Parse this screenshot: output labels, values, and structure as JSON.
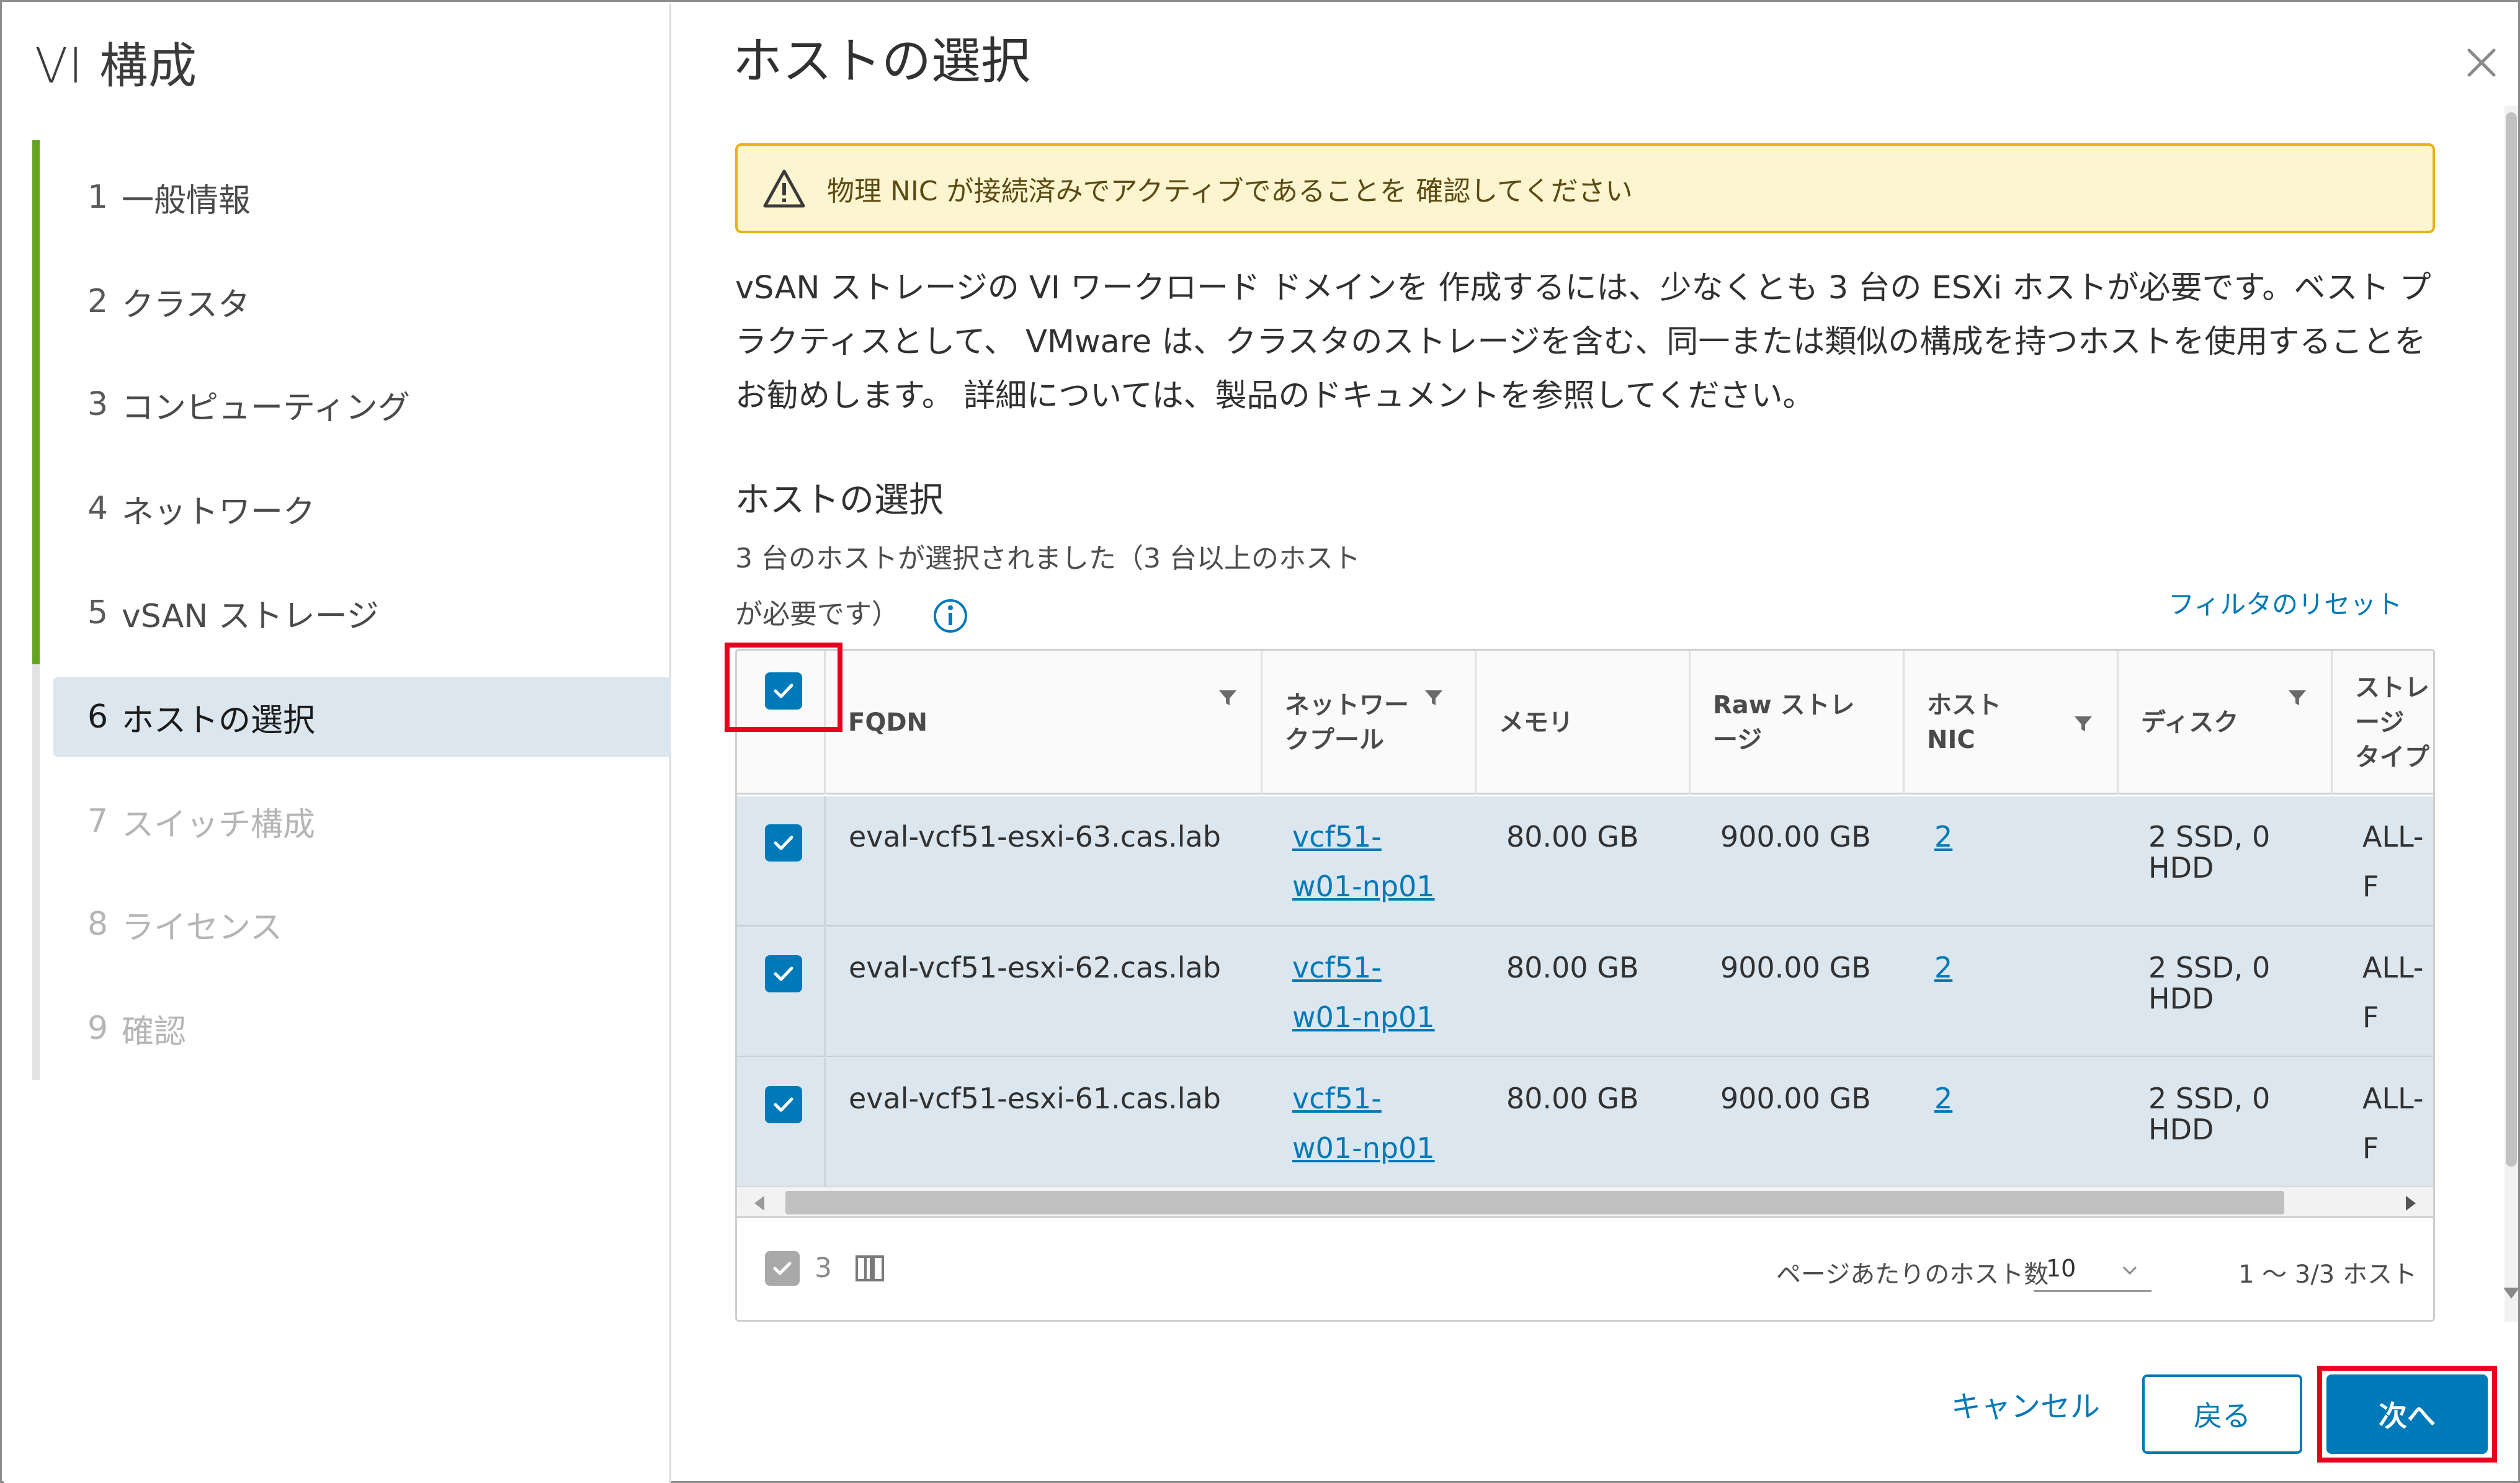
{
  "app": {
    "title": "VI 構成"
  },
  "steps": [
    {
      "num": "1",
      "label": "一般情報",
      "state": "done"
    },
    {
      "num": "2",
      "label": "クラスタ",
      "state": "done"
    },
    {
      "num": "3",
      "label": "コンピューティング",
      "state": "done"
    },
    {
      "num": "4",
      "label": "ネットワーク",
      "state": "done"
    },
    {
      "num": "5",
      "label": "vSAN ストレージ",
      "state": "done"
    },
    {
      "num": "6",
      "label": "ホストの選択",
      "state": "active"
    },
    {
      "num": "7",
      "label": "スイッチ構成",
      "state": "future"
    },
    {
      "num": "8",
      "label": "ライセンス",
      "state": "future"
    },
    {
      "num": "9",
      "label": "確認",
      "state": "future"
    }
  ],
  "page": {
    "title": "ホストの選択",
    "alert": "物理 NIC が接続済みでアクティブであることを 確認してください",
    "description": "vSAN ストレージの VI ワークロード ドメインを 作成するには、少なくとも 3 台の ESXi ホストが必要です。ベスト プラクティスとして、 VMware は、クラスタのストレージを含む、同一または類似の構成を持つホストを使用することをお勧めします。 詳細については、製品のドキュメントを参照してください。",
    "section_title": "ホストの選択",
    "selection_status_line1": "3 台のホストが選択されました（3 台以上のホスト",
    "selection_status_line2": "が必要です）",
    "reset_filter": "フィルタのリセット"
  },
  "grid": {
    "columns": {
      "fqdn": "FQDN",
      "network_pool": "ネットワークプール",
      "memory": "メモリ",
      "raw_storage": "Raw ストレージ",
      "host_nic": "ホスト NIC",
      "disk": "ディスク",
      "storage_type": "ストレージ タイプ"
    },
    "rows": [
      {
        "fqdn": "eval-vcf51-esxi-63.cas.lab",
        "pool": "vcf51-w01-np01",
        "memory": "80.00 GB",
        "raw": "900.00 GB",
        "nic": "2",
        "disk": "2 SSD, 0 HDD",
        "type": "ALL-F"
      },
      {
        "fqdn": "eval-vcf51-esxi-62.cas.lab",
        "pool": "vcf51-w01-np01",
        "memory": "80.00 GB",
        "raw": "900.00 GB",
        "nic": "2",
        "disk": "2 SSD, 0 HDD",
        "type": "ALL-F"
      },
      {
        "fqdn": "eval-vcf51-esxi-61.cas.lab",
        "pool": "vcf51-w01-np01",
        "memory": "80.00 GB",
        "raw": "900.00 GB",
        "nic": "2",
        "disk": "2 SSD, 0 HDD",
        "type": "ALL-F"
      }
    ],
    "footer": {
      "selected_count": "3",
      "per_page_label": "ページあたりのホスト数",
      "per_page_value": "10",
      "pager_info": "1 ～ 3/3 ホスト"
    }
  },
  "buttons": {
    "cancel": "キャンセル",
    "back": "戻る",
    "next": "次へ"
  },
  "colors": {
    "accent": "#0079b8",
    "progress": "#62a420",
    "selected_row": "#dbe6ee",
    "highlight": "#e8001c",
    "alert_bg": "#fdf5cf",
    "alert_border": "#e6b11e"
  }
}
